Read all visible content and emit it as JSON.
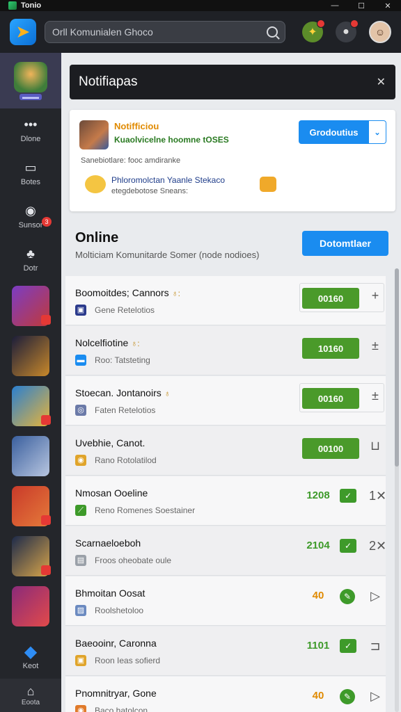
{
  "window": {
    "title": "Tonio",
    "icons": [
      "minimize-icon",
      "maximize-icon",
      "close-icon"
    ]
  },
  "topbar": {
    "search_text": "Orll Komunialen Ghoco",
    "icons": [
      "logo-icon",
      "search-icon",
      "gift-icon",
      "friend-request-icon",
      "avatar"
    ]
  },
  "sidebar": {
    "items": [
      {
        "label": "Dlone",
        "icon": "dots-icon"
      },
      {
        "label": "Botes",
        "icon": "monitor-icon"
      },
      {
        "label": "Sunsor",
        "icon": "eye-icon",
        "badge": "3"
      },
      {
        "label": "Dotr",
        "icon": "bolt-icon"
      }
    ],
    "games": [
      {
        "colors": [
          "#7b3cc4",
          "#c03a3a"
        ],
        "badge": true
      },
      {
        "colors": [
          "#1b1d3a",
          "#c8882a"
        ],
        "badge": false
      },
      {
        "colors": [
          "#2a7fd0",
          "#e7b43a"
        ],
        "badge": true
      },
      {
        "colors": [
          "#3a5f9e",
          "#b8c6e0"
        ],
        "badge": false
      },
      {
        "colors": [
          "#c93a2a",
          "#e57a3a"
        ],
        "badge": true
      },
      {
        "colors": [
          "#1d2a4a",
          "#d8a54a"
        ],
        "badge": true
      },
      {
        "colors": [
          "#8a2a7a",
          "#e24a4a"
        ],
        "badge": false
      }
    ],
    "bottom_1": {
      "label": "Keot",
      "icon": "puzzle-icon"
    },
    "bottom_2": {
      "label": "Eoota",
      "icon": "home-icon"
    }
  },
  "notifications": {
    "header": "Notifiapas",
    "card": {
      "title": "Notifficiou",
      "subtitle": "Kuaolvicelne hoomne tOSES",
      "button_label": "Grodoutius",
      "line": "Sanebiotlare: fooc amdiranke",
      "message_1": "Phloromolctan Yaanle   Stekaco",
      "message_2": "etegdebotose Sneans:"
    }
  },
  "online": {
    "title": "Online",
    "subtitle": "Molticiam Komunitarde Somer (node nodioes)",
    "button_label": "Dotomtlaer"
  },
  "friends": [
    {
      "name": "Boomoitdes; Cannors",
      "mark": "♁:",
      "status": "Gene Retelotios",
      "icon_color": "#2b3a8c",
      "icon": "▣",
      "kind": "pill",
      "value": "00160",
      "framed": true,
      "action": "+"
    },
    {
      "name": "Nolcelfiotine",
      "mark": "♁:",
      "status": "Roo: Tatsteting",
      "icon_color": "#1a8cf0",
      "icon": "▬",
      "kind": "pill",
      "value": "10160",
      "framed": false,
      "action": "±"
    },
    {
      "name": "Stoecan. Jontanoirs",
      "mark": "♁",
      "status": "Faten Retelotios",
      "icon_color": "#6b7aa8",
      "icon": "◎",
      "kind": "pill",
      "value": "00160",
      "framed": true,
      "action": "±"
    },
    {
      "name": "Uvebhie, Canot.",
      "mark": "",
      "status": "Rano Rotolatilod",
      "icon_color": "#e0a42a",
      "icon": "◉",
      "kind": "pill",
      "value": "00100",
      "framed": false,
      "action": "⊔"
    },
    {
      "name": "Nmosan Ooeline",
      "mark": "",
      "status": "Reno Romenes Soestainer",
      "icon_color": "#3e9a2a",
      "icon": "⟋",
      "kind": "num",
      "value": "1208",
      "num_color": "#3e9a2a",
      "check": "✓",
      "action": "1✕"
    },
    {
      "name": "Scarnaeloeboh",
      "mark": "",
      "status": "Froos oheobate oule",
      "icon_color": "#9aa0a8",
      "icon": "▤",
      "kind": "num",
      "value": "2104",
      "num_color": "#3e9a2a",
      "check": "✓",
      "action": "2✕"
    },
    {
      "name": "Bhmoitan Oosat",
      "mark": "",
      "status": "Roolshetoloo",
      "icon_color": "#6b8ac0",
      "icon": "▨",
      "kind": "num",
      "value": "40",
      "num_color": "#e08a00",
      "check": "✎",
      "round": true,
      "action": "▷"
    },
    {
      "name": "Baeooinr, Caronna",
      "mark": "",
      "status": "Roon Ieas sofierd",
      "icon_color": "#e0a42a",
      "icon": "▣",
      "kind": "num",
      "value": "1101",
      "num_color": "#3e9a2a",
      "check": "✓",
      "action": "⊐"
    },
    {
      "name": "Pnomnitryar, Gone",
      "mark": "",
      "status": "Baco hatolcon",
      "icon_color": "#e07a2a",
      "icon": "◉",
      "kind": "num",
      "value": "40",
      "num_color": "#e08a00",
      "check": "✎",
      "round": true,
      "action": "▷"
    }
  ]
}
